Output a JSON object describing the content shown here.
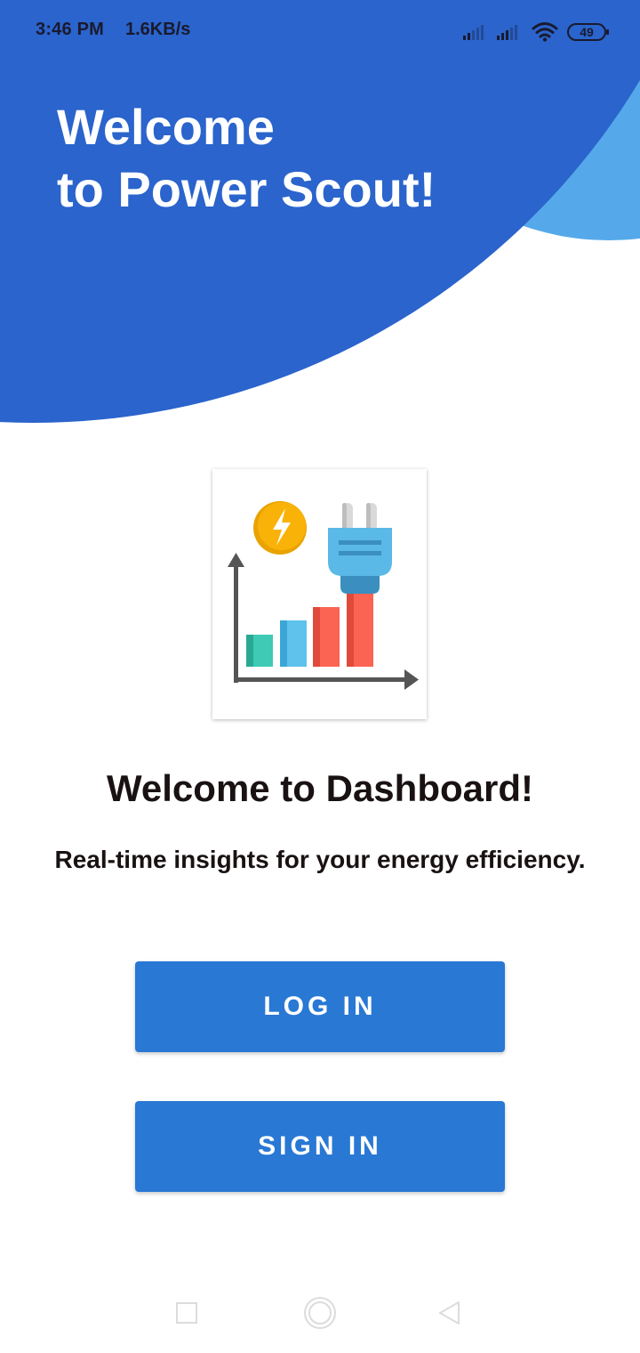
{
  "status_bar": {
    "time": "3:46 PM",
    "network_speed": "1.6KB/s",
    "battery_level": "49",
    "icons": [
      "signal-icon",
      "signal-icon",
      "wifi-icon",
      "battery-icon"
    ]
  },
  "header": {
    "title_line1": "Welcome",
    "title_line2": "to Power Scout!"
  },
  "illustration": {
    "icon": "energy-chart-plug-icon",
    "colors": {
      "bolt_circle": "#f9b208",
      "plug": "#5ab9e6",
      "bar1": "#3ecab4",
      "bar2": "#5ec2ed",
      "bar3": "#fb6352",
      "axis": "#555555"
    }
  },
  "main": {
    "heading": "Welcome to Dashboard!",
    "tagline": "Real-time insights for your energy efficiency."
  },
  "actions": {
    "login_label": "LOG IN",
    "signin_label": "SIGN IN"
  },
  "nav_bar": {
    "icons": [
      "recent-apps-icon",
      "home-icon",
      "back-icon"
    ]
  },
  "theme": {
    "primary_dark": "#2a64cc",
    "primary_light": "#55a9ea",
    "button": "#2878d4"
  }
}
